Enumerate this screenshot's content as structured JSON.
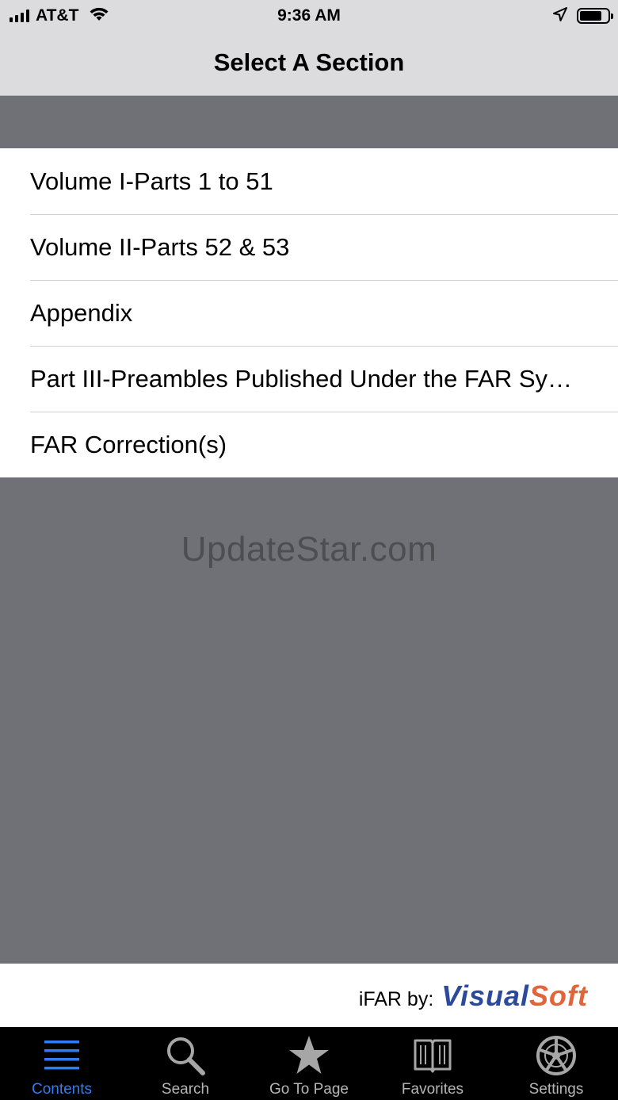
{
  "status_bar": {
    "carrier": "AT&T",
    "time": "9:36 AM",
    "icons": [
      "signal-icon",
      "wifi-icon",
      "location-icon",
      "battery-icon"
    ]
  },
  "nav": {
    "title": "Select A Section"
  },
  "sections": [
    {
      "label": "Volume I-Parts 1 to 51"
    },
    {
      "label": "Volume II-Parts 52 & 53"
    },
    {
      "label": "Appendix"
    },
    {
      "label": "Part III-Preambles Published Under the FAR Sy…"
    },
    {
      "label": "FAR Correction(s)"
    }
  ],
  "watermark": "UpdateStar.com",
  "footer": {
    "prefix": "iFAR by:",
    "logo_part1": "Visual",
    "logo_part2": "Soft",
    "logo_colors": {
      "part1": "#2c4a9c",
      "part2": "#e0653a"
    }
  },
  "tabs": [
    {
      "label": "Contents",
      "icon": "list-icon",
      "active": true
    },
    {
      "label": "Search",
      "icon": "search-icon",
      "active": false
    },
    {
      "label": "Go To Page",
      "icon": "star-icon",
      "active": false
    },
    {
      "label": "Favorites",
      "icon": "book-icon",
      "active": false
    },
    {
      "label": "Settings",
      "icon": "wheel-icon",
      "active": false
    }
  ],
  "colors": {
    "accent": "#2f7cf5",
    "background": "#707176",
    "bar": "#dcdcde"
  }
}
